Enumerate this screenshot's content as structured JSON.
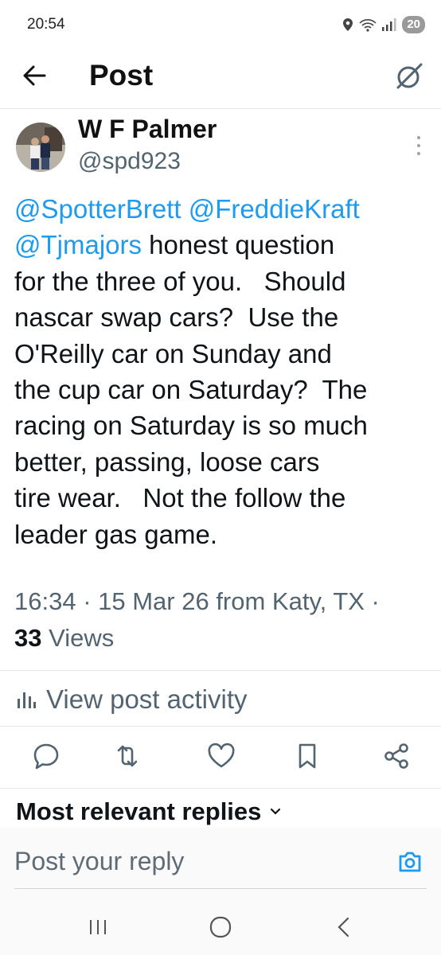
{
  "status_bar": {
    "time": "20:54",
    "battery": "20"
  },
  "header": {
    "title": "Post"
  },
  "author": {
    "name": "W F Palmer",
    "handle": "@spd923"
  },
  "tweet": {
    "mentions": [
      "@SpotterBrett",
      "@FreddieKraft",
      "@Tjmajors"
    ],
    "lines": [
      " honest question",
      "for the three of you.   Should",
      "nascar swap cars?  Use the",
      "O'Reilly car on Sunday and",
      "the cup car on Saturday?  The",
      "racing on Saturday is so much",
      "better, passing, loose cars",
      "tire wear.   Not the follow the",
      "leader gas game."
    ]
  },
  "meta": {
    "info": "16:34 · 15 Mar 26 from Katy, TX ·",
    "views_count": "33",
    "views_label": " Views"
  },
  "activity": {
    "label": "View post activity"
  },
  "replies": {
    "heading": "Most relevant replies"
  },
  "reply_box": {
    "placeholder": "Post your reply"
  },
  "icons": {
    "back": "arrow-left-icon",
    "grok": "grok-icon",
    "more": "more-vertical-icon",
    "reply": "reply-icon",
    "repost": "repost-icon",
    "like": "heart-icon",
    "bookmark": "bookmark-icon",
    "share": "share-icon",
    "camera": "camera-icon",
    "analytics": "analytics-icon",
    "chevron": "chevron-down-icon"
  },
  "colors": {
    "link": "#1d9bf0",
    "secondary": "#536471",
    "text": "#0f1419"
  }
}
